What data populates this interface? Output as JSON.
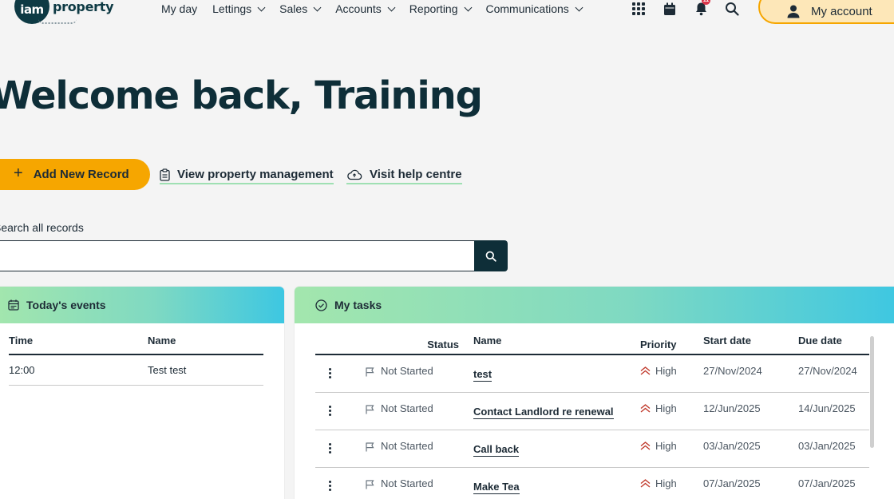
{
  "header": {
    "logo_mark": "iam",
    "logo_word": "property",
    "nav": [
      {
        "label": "My day",
        "dropdown": false
      },
      {
        "label": "Lettings",
        "dropdown": true
      },
      {
        "label": "Sales",
        "dropdown": true
      },
      {
        "label": "Accounts",
        "dropdown": true
      },
      {
        "label": "Reporting",
        "dropdown": true
      },
      {
        "label": "Communications",
        "dropdown": true
      }
    ],
    "icons": [
      "apps-grid-icon",
      "calendar-icon",
      "bell-icon",
      "search-icon"
    ],
    "notification_count": "11",
    "account_label": "My account"
  },
  "welcome": {
    "title": "Welcome back, Training"
  },
  "actions": {
    "add_record": "Add New Record",
    "view_property_management": "View property management",
    "visit_help_centre": "Visit help centre"
  },
  "search": {
    "label": "Search all records",
    "placeholder": "",
    "value": ""
  },
  "events": {
    "title": "Today's events",
    "columns": [
      "Time",
      "Name"
    ],
    "rows": [
      {
        "time": "12:00",
        "name": "Test test"
      }
    ]
  },
  "tasks": {
    "title": "My tasks",
    "columns": [
      "Status",
      "Name",
      "Priority",
      "Start date",
      "Due date"
    ],
    "rows": [
      {
        "status": "Not Started",
        "name": "test",
        "priority": "High",
        "start": "27/Nov/2024",
        "due": "27/Nov/2024"
      },
      {
        "status": "Not Started",
        "name": "Contact Landlord re renewal",
        "priority": "High",
        "start": "12/Jun/2025",
        "due": "14/Jun/2025"
      },
      {
        "status": "Not Started",
        "name": "Call back",
        "priority": "High",
        "start": "03/Jan/2025",
        "due": "03/Jan/2025"
      },
      {
        "status": "Not Started",
        "name": "Make Tea",
        "priority": "High",
        "start": "07/Jan/2025",
        "due": "07/Jan/2025"
      }
    ]
  },
  "colors": {
    "accent": "#f6a600",
    "dark": "#0e2e38",
    "gradient_start": "#a3e6ad",
    "gradient_end": "#3dc7e2",
    "priority_high": "#c0392b"
  }
}
